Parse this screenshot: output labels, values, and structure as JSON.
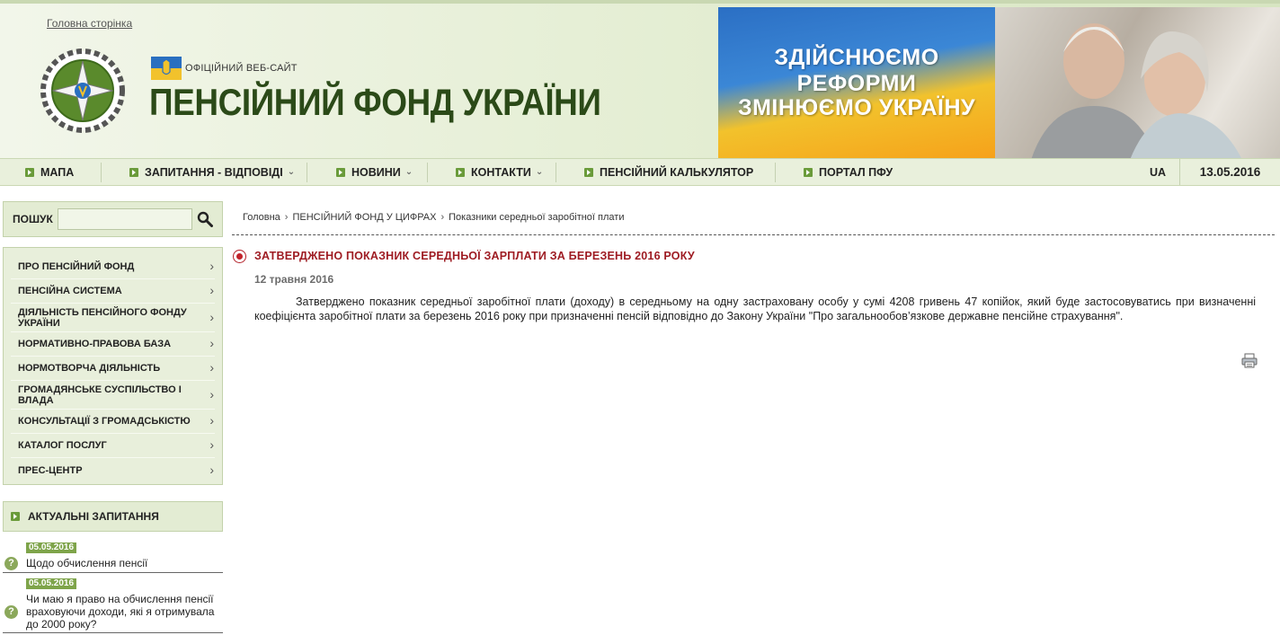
{
  "header": {
    "home_link": "Головна сторінка",
    "official_label": "ОФІЦІЙНИЙ ВЕБ-САЙТ",
    "site_title": "ПЕНСІЙНИЙ ФОНД УКРАЇНИ",
    "banner": {
      "line1": "ЗДІЙСНЮЄМО РЕФОРМИ",
      "line2": "ЗМІНЮЄМО УКРАЇНУ"
    }
  },
  "nav": {
    "items": [
      {
        "label": "МАПА",
        "dropdown": false
      },
      {
        "label": "ЗАПИТАННЯ - ВІДПОВІДІ",
        "dropdown": true
      },
      {
        "label": "НОВИНИ",
        "dropdown": true
      },
      {
        "label": "КОНТАКТИ",
        "dropdown": true
      },
      {
        "label": "ПЕНСІЙНИЙ КАЛЬКУЛЯТОР",
        "dropdown": false
      },
      {
        "label": "ПОРТАЛ ПФУ",
        "dropdown": false
      }
    ],
    "lang": "UA",
    "date": "13.05.2016"
  },
  "search": {
    "label": "ПОШУК",
    "placeholder": "",
    "value": ""
  },
  "menu": {
    "items": [
      "ПРО ПЕНСІЙНИЙ ФОНД",
      "ПЕНСІЙНА СИСТЕМА",
      "ДІЯЛЬНІСТЬ ПЕНСІЙНОГО ФОНДУ УКРАЇНИ",
      "НОРМАТИВНО-ПРАВОВА БАЗА",
      "НОРМОТВОРЧА ДІЯЛЬНІСТЬ",
      "ГРОМАДЯНСЬКЕ СУСПІЛЬСТВО І ВЛАДА",
      "КОНСУЛЬТАЦІЇ З ГРОМАДСЬКІСТЮ",
      "КАТАЛОГ ПОСЛУГ",
      "ПРЕС-ЦЕНТР"
    ]
  },
  "questions": {
    "heading": "АКТУАЛЬНІ ЗАПИТАННЯ",
    "items": [
      {
        "date": "05.05.2016",
        "text": "Щодо обчислення пенсії"
      },
      {
        "date": "05.05.2016",
        "text": "Чи маю я право на обчислення пенсії враховуючи доходи, які я отримувала до 2000 року?"
      }
    ]
  },
  "breadcrumb": [
    "Головна",
    "ПЕНСІЙНИЙ ФОНД У ЦИФРАХ",
    "Показники середньої заробітної плати"
  ],
  "article": {
    "title": "ЗАТВЕРДЖЕНО ПОКАЗНИК СЕРЕДНЬОЇ ЗАРПЛАТИ ЗА БЕРЕЗЕНЬ 2016 РОКУ",
    "date": "12 травня 2016",
    "body": "Затверджено показник середньої заробітної плати (доходу) в середньому на одну застраховану особу у сумі 4208 гривень 47 копійок, який буде застосовуватись при визначенні коефіцієнта заробітної плати за березень 2016 року при призначенні пенсій відповідно до Закону України \"Про загальнообов’язкове державне пенсійне страхування\"."
  },
  "colors": {
    "accent_green": "#6a9b3a",
    "title_red": "#9e1c23",
    "site_title_green": "#2b4a18"
  }
}
